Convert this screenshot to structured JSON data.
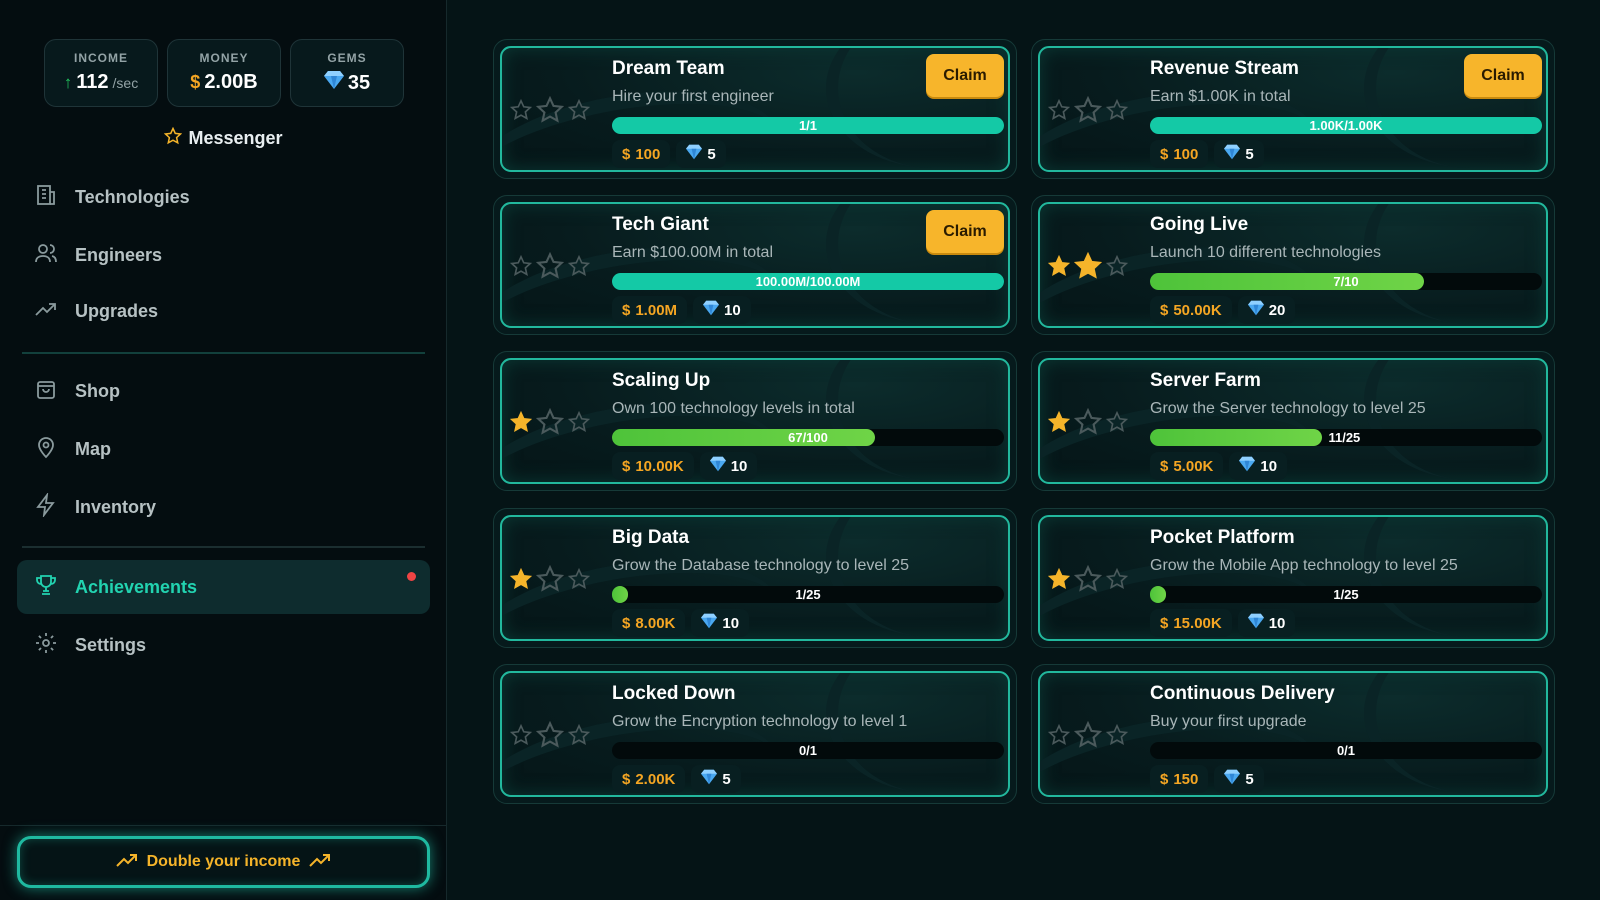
{
  "stats": {
    "income_label": "INCOME",
    "income_value": "112",
    "income_unit": "/sec",
    "money_label": "MONEY",
    "money_symbol": "$",
    "money_value": "2.00B",
    "gems_label": "GEMS",
    "gems_value": "35"
  },
  "company": {
    "name": "Messenger",
    "icon": "star-outline-icon"
  },
  "nav": {
    "technologies": "Technologies",
    "engineers": "Engineers",
    "upgrades": "Upgrades",
    "shop": "Shop",
    "map": "Map",
    "inventory": "Inventory",
    "achievements": "Achievements",
    "settings": "Settings"
  },
  "double_income": "Double your income",
  "claim_label": "Claim",
  "currency_symbol": "$",
  "colors": {
    "accent": "#22d3b0",
    "gold": "#f5b42a",
    "progress_green": "#5cc93f",
    "progress_teal": "#14c9a6"
  },
  "achievements": [
    {
      "title": "Dream Team",
      "desc": "Hire your first engineer",
      "progress": "1/1",
      "fraction": 1.0,
      "money": "100",
      "gems": "5",
      "stars": 0,
      "claim": true
    },
    {
      "title": "Revenue Stream",
      "desc": "Earn $1.00K in total",
      "progress": "1.00K/1.00K",
      "fraction": 1.0,
      "money": "100",
      "gems": "5",
      "stars": 0,
      "claim": true
    },
    {
      "title": "Tech Giant",
      "desc": "Earn $100.00M in total",
      "progress": "100.00M/100.00M",
      "fraction": 1.0,
      "money": "1.00M",
      "gems": "10",
      "stars": 0,
      "claim": true
    },
    {
      "title": "Going Live",
      "desc": "Launch 10 different technologies",
      "progress": "7/10",
      "fraction": 0.7,
      "money": "50.00K",
      "gems": "20",
      "stars": 2,
      "claim": false
    },
    {
      "title": "Scaling Up",
      "desc": "Own 100 technology levels in total",
      "progress": "67/100",
      "fraction": 0.67,
      "money": "10.00K",
      "gems": "10",
      "stars": 1,
      "claim": false
    },
    {
      "title": "Server Farm",
      "desc": "Grow the Server technology to level 25",
      "progress": "11/25",
      "fraction": 0.44,
      "money": "5.00K",
      "gems": "10",
      "stars": 1,
      "claim": false
    },
    {
      "title": "Big Data",
      "desc": "Grow the Database technology to level 25",
      "progress": "1/25",
      "fraction": 0.04,
      "money": "8.00K",
      "gems": "10",
      "stars": 1,
      "claim": false
    },
    {
      "title": "Pocket Platform",
      "desc": "Grow the Mobile App technology to level 25",
      "progress": "1/25",
      "fraction": 0.04,
      "money": "15.00K",
      "gems": "10",
      "stars": 1,
      "claim": false
    },
    {
      "title": "Locked Down",
      "desc": "Grow the Encryption technology to level 1",
      "progress": "0/1",
      "fraction": 0,
      "money": "2.00K",
      "gems": "5",
      "stars": 0,
      "claim": false
    },
    {
      "title": "Continuous Delivery",
      "desc": "Buy your first upgrade",
      "progress": "0/1",
      "fraction": 0,
      "money": "150",
      "gems": "5",
      "stars": 0,
      "claim": false
    }
  ]
}
